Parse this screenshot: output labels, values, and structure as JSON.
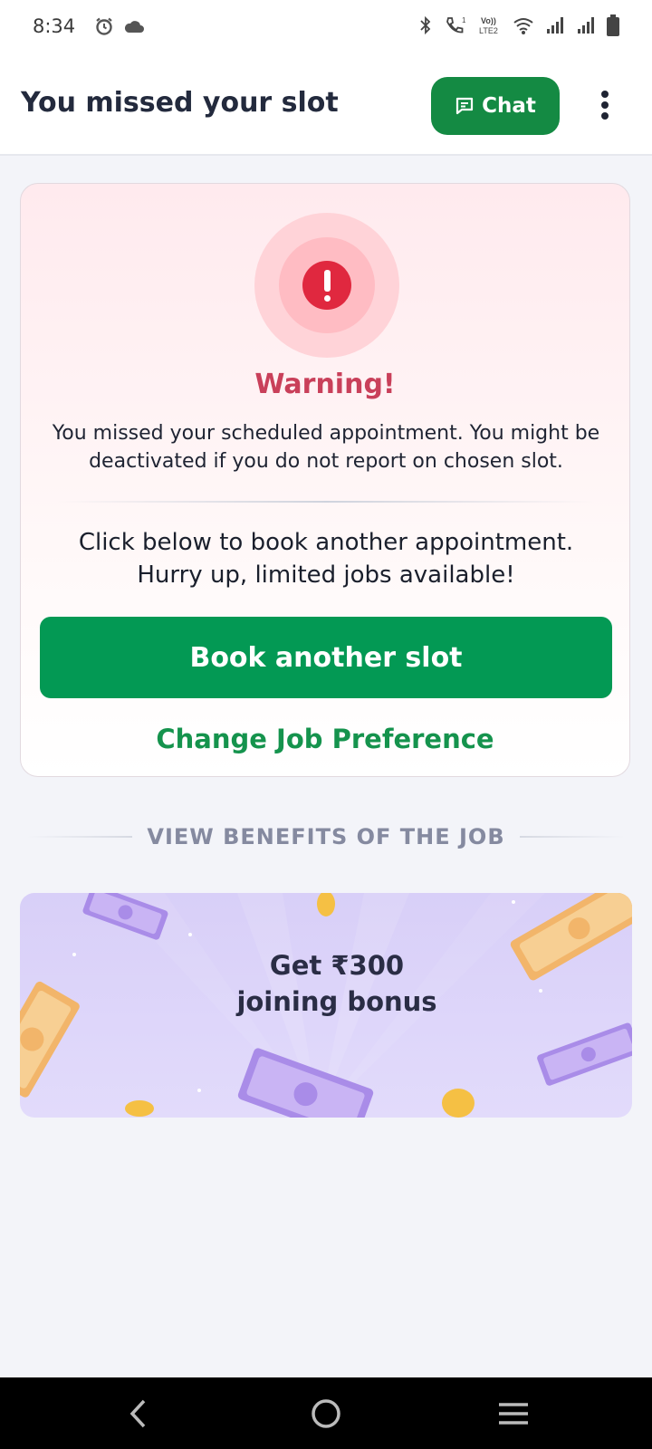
{
  "status_bar": {
    "time": "8:34",
    "icons": [
      "alarm-icon",
      "cloud-icon",
      "bluetooth-icon",
      "call-icon",
      "volte-icon",
      "wifi-icon",
      "signal-icon",
      "signal-icon",
      "battery-icon"
    ],
    "volte_label": "LTE2"
  },
  "header": {
    "title": "You missed your slot",
    "chat_label": "Chat",
    "chat_icon": "chat-icon",
    "menu_icon": "more-vertical-icon"
  },
  "warning_card": {
    "icon": "exclamation-alert-icon",
    "title": "Warning!",
    "message": "You missed your scheduled appointment. You might be deactivated if you do not report on chosen slot.",
    "prompt_line1": "Click below to book another appointment.",
    "prompt_line2": "Hurry up, limited jobs available!",
    "book_button": "Book another slot",
    "change_link": "Change Job Preference"
  },
  "benefits": {
    "heading": "VIEW BENEFITS OF THE JOB",
    "banner_line1": "Get ₹300",
    "banner_line2": "joining bonus"
  },
  "nav_bar": {
    "items": [
      "back-icon",
      "home-icon",
      "recents-icon"
    ]
  },
  "colors": {
    "primary_green": "#039954",
    "chat_green": "#148a43",
    "warning_red": "#e0283f",
    "warning_title": "#c9405a",
    "banner_purple": "#d8cff8"
  }
}
